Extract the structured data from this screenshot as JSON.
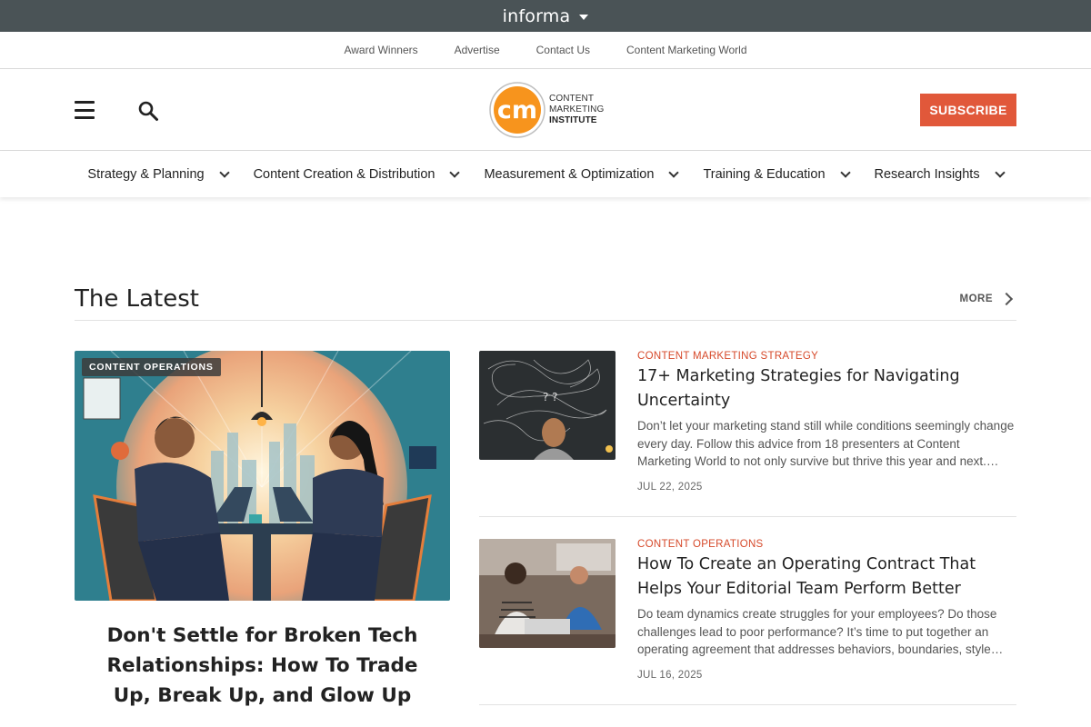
{
  "informa": {
    "brand": "informa"
  },
  "utility_links": [
    "Award Winners",
    "Advertise",
    "Contact Us",
    "Content Marketing World"
  ],
  "header": {
    "logo_mark": "cm",
    "logo_lines": [
      "CONTENT",
      "MARKETING",
      "INSTITUTE"
    ],
    "subscribe_label": "SUBSCRIBE"
  },
  "main_nav": [
    "Strategy & Planning",
    "Content Creation & Distribution",
    "Measurement & Optimization",
    "Training & Education",
    "Research Insights"
  ],
  "latest": {
    "title": "The Latest",
    "more_label": "MORE",
    "feature": {
      "tag": "CONTENT OPERATIONS",
      "title": "Don't Settle for Broken Tech Relationships: How To Trade Up, Break Up, and Glow Up"
    },
    "articles": [
      {
        "category": "CONTENT MARKETING STRATEGY",
        "title": "17+ Marketing Strategies for Navigating Uncertainty",
        "summary": "Don’t let your marketing stand still while conditions seemingly change every day. Follow this advice from 18 presenters at Content Marketing World to not only survive but thrive this year and next.…",
        "date": "JUL 22, 2025"
      },
      {
        "category": "CONTENT OPERATIONS",
        "title": "How To Create an Operating Contract That Helps Your Editorial Team Perform Better",
        "summary": "Do team dynamics create struggles for your employees? Do those challenges lead to poor performance? It’s time to put together an operating agreement that addresses behaviors, boundaries, style…",
        "date": "JUL 16, 2025"
      }
    ]
  },
  "colors": {
    "accent": "#e1583a",
    "category": "#d6492a",
    "topbar": "#4a5356",
    "logo_orange": "#f7941d"
  }
}
